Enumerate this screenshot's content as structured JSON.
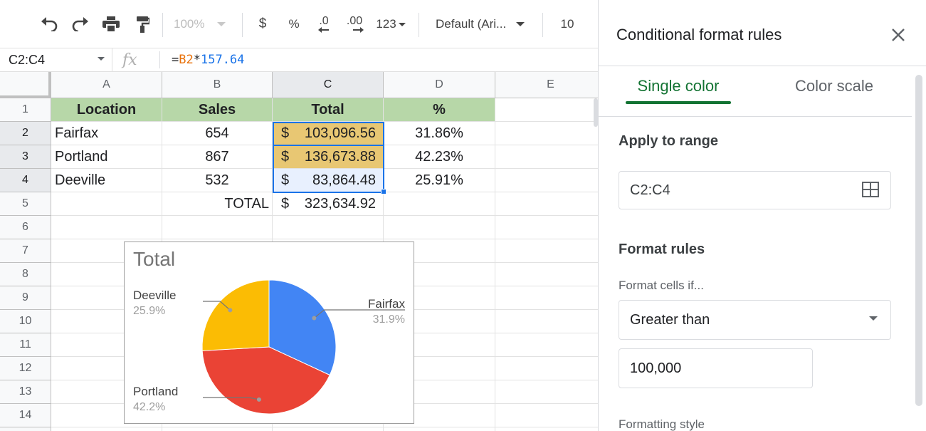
{
  "toolbar": {
    "zoom": "100%",
    "currency": "$",
    "percent": "%",
    "dec_decrease": ".0",
    "dec_increase": ".00",
    "more_formats": "123",
    "font": "Default (Ari...",
    "font_size": "10"
  },
  "formula_bar": {
    "name_box": "C2:C4",
    "fx": "fx",
    "formula_eq": "=",
    "formula_ref": "B2",
    "formula_op": "*",
    "formula_num": "157.64"
  },
  "sheet": {
    "columns": [
      "A",
      "B",
      "C",
      "D",
      "E"
    ],
    "rows": [
      "1",
      "2",
      "3",
      "4",
      "5",
      "6",
      "7",
      "8",
      "9",
      "10",
      "11",
      "12",
      "13",
      "14"
    ],
    "header": {
      "location": "Location",
      "sales": "Sales",
      "total": "Total",
      "pct": "%"
    },
    "data": [
      {
        "location": "Fairfax",
        "sales": "654",
        "cur": "$",
        "total": "103,096.56",
        "pct": "31.86%"
      },
      {
        "location": "Portland",
        "sales": "867",
        "cur": "$",
        "total": "136,673.88",
        "pct": "42.23%"
      },
      {
        "location": "Deeville",
        "sales": "532",
        "cur": "$",
        "total": "83,864.48",
        "pct": "25.91%"
      }
    ],
    "total_label": "TOTAL",
    "total_cur": "$",
    "total_value": "323,634.92",
    "highlight_color": "#e8c773",
    "header_color": "#b7d7a8"
  },
  "chart_data": {
    "type": "pie",
    "title": "Total",
    "slices": [
      {
        "label": "Fairfax",
        "pct_label": "31.9%",
        "value": 31.9,
        "color": "#4285f4"
      },
      {
        "label": "Portland",
        "pct_label": "42.2%",
        "value": 42.2,
        "color": "#ea4335"
      },
      {
        "label": "Deeville",
        "pct_label": "25.9%",
        "value": 25.9,
        "color": "#fbbc04"
      }
    ]
  },
  "panel": {
    "title": "Conditional format rules",
    "tab_single": "Single color",
    "tab_scale": "Color scale",
    "apply_label": "Apply to range",
    "range_value": "C2:C4",
    "rules_label": "Format rules",
    "cells_if_label": "Format cells if...",
    "condition": "Greater than",
    "value": "100,000",
    "style_label": "Formatting style",
    "accent": "#137333"
  }
}
